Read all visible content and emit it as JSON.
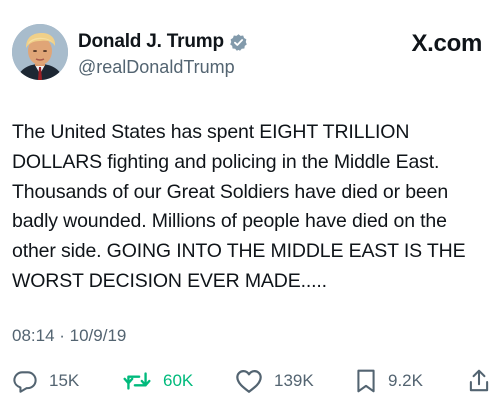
{
  "tweet": {
    "display_name": "Donald J. Trump",
    "handle": "@realDonaldTrump",
    "brand": "X.com",
    "text": "The United States has spent EIGHT TRILLION DOLLARS fighting and policing in the Middle East. Thousands of our Great Soldiers have died or been badly wounded. Millions of people have died on the other side. GOING INTO THE MIDDLE EAST IS THE WORST DECISION EVER MADE.....",
    "timestamp": "08:14 · 10/9/19",
    "verified": true
  },
  "actions": {
    "replies": {
      "icon": "reply-icon",
      "count": "15K"
    },
    "retweets": {
      "icon": "retweet-icon",
      "count": "60K"
    },
    "likes": {
      "icon": "like-icon",
      "count": "139K"
    },
    "bookmarks": {
      "icon": "bookmark-icon",
      "count": "9.2K"
    },
    "share": {
      "icon": "share-icon"
    }
  },
  "colors": {
    "text_primary": "#0f1419",
    "text_secondary": "#536471",
    "retweet_green": "#00ba7c",
    "verified_badge": "#829aab"
  }
}
